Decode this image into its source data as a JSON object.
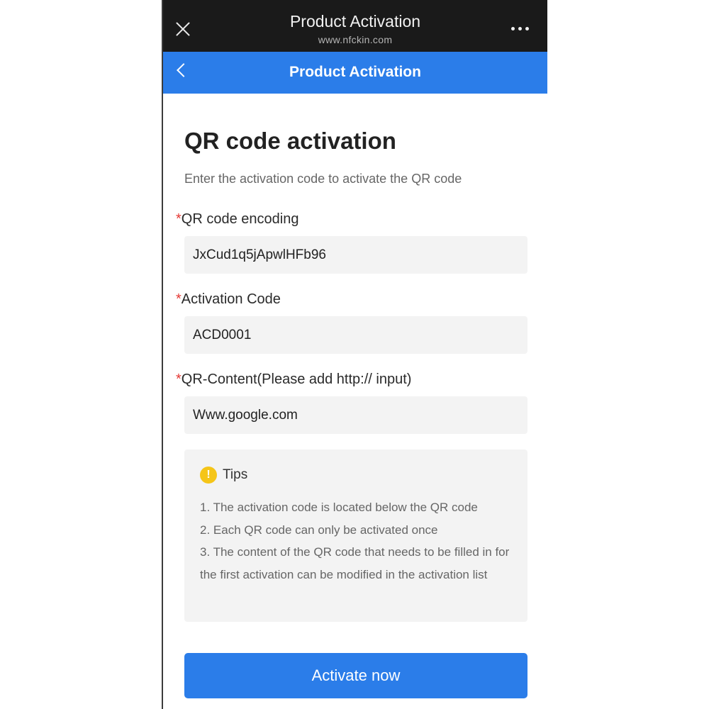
{
  "browser": {
    "title": "Product Activation",
    "domain": "www.nfckin.com"
  },
  "navbar": {
    "title": "Product Activation"
  },
  "page": {
    "heading": "QR code activation",
    "description": "Enter the activation code to activate the QR code"
  },
  "form": {
    "required_marker": "*",
    "encoding_label": "QR code encoding",
    "encoding_value": "JxCud1q5jApwlHFb96",
    "activation_label": "Activation Code",
    "activation_value": "ACD0001",
    "content_label": "QR-Content(Please add http:// input)",
    "content_value": "Www.google.com"
  },
  "tips": {
    "icon_glyph": "!",
    "title": "Tips",
    "items": [
      "1. The activation code is located below the QR code",
      "2. Each QR code can only be activated once",
      "3. The content of the QR code that needs to be filled in for the first activation can be modified in the activation list"
    ]
  },
  "actions": {
    "activate_label": "Activate now"
  },
  "colors": {
    "brand_blue": "#2b7de9",
    "required_red": "#e53935",
    "warning_yellow": "#f5c518",
    "topbar_dark": "#1a1a1a"
  }
}
